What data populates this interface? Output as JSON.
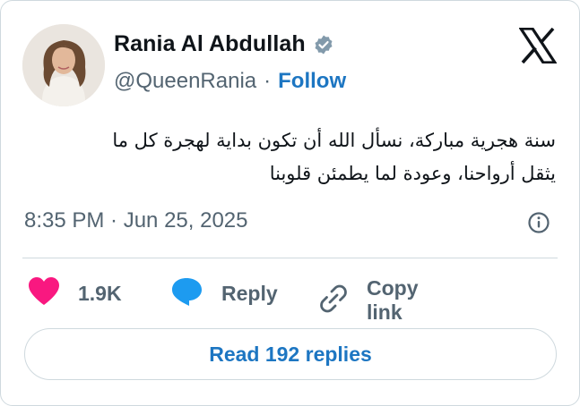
{
  "author": {
    "name": "Rania Al Abdullah",
    "handle": "@QueenRania",
    "separator": "·",
    "follow_label": "Follow",
    "verified_color": "#829aab"
  },
  "tweet": {
    "text_line1": "سنة هجرية مباركة، نسأل الله أن تكون بداية لهجرة كل ما",
    "text_line2": "يثقل أرواحنا، وعودة لما يطمئن قلوبنا",
    "timestamp": "8:35 PM · Jun 25, 2025"
  },
  "actions": {
    "like_count": "1.9K",
    "reply_label": "Reply",
    "copy_link_label": "Copy link"
  },
  "footer": {
    "read_replies_label": "Read 192 replies"
  },
  "colors": {
    "accent": "#1d76c2",
    "like": "#f91880",
    "reply_icon": "#1d9bf0",
    "muted": "#536471",
    "border": "#cfd9de"
  },
  "icons": [
    "verified-badge-icon",
    "x-logo-icon",
    "info-icon",
    "heart-icon",
    "comment-icon",
    "link-icon"
  ]
}
